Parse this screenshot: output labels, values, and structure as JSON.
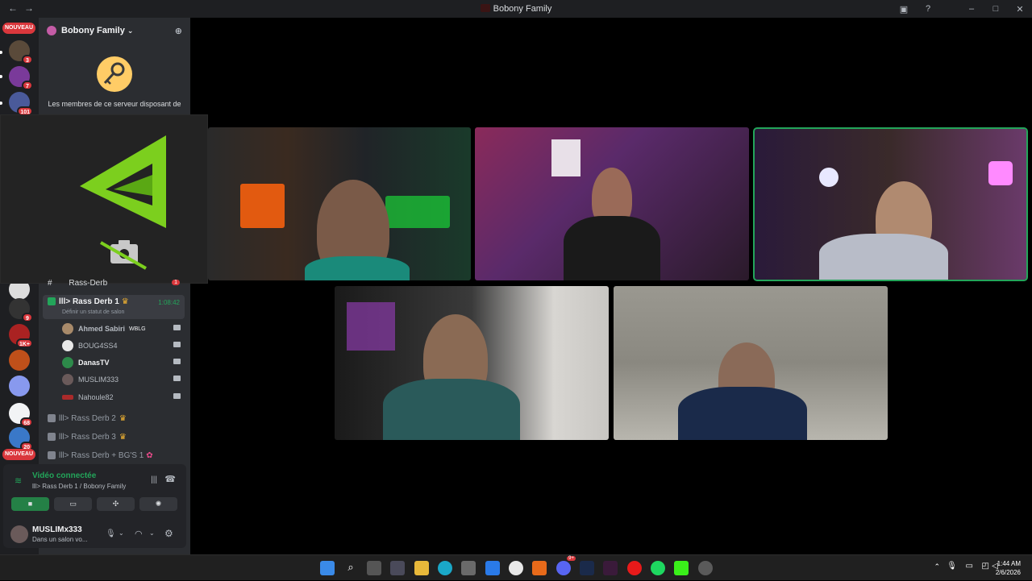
{
  "window": {
    "title": "Bobony Family",
    "nav": "←→"
  },
  "titlebar_icons": [
    "screen-share-icon",
    "help-icon",
    "minimize-icon",
    "maximize-icon",
    "close-icon"
  ],
  "servers": {
    "nouveau_top": "NOUVEAU",
    "nouveau_bottom": "NOUVEAU",
    "badges": [
      "3",
      "7",
      "101",
      "9",
      "1K+",
      "68",
      "20"
    ]
  },
  "guild": {
    "name": "Bobony Family",
    "boost_text": "Les membres de ce serveur disposant de"
  },
  "channels": {
    "partial_channel": "Rass-Derb",
    "partial_badge": "1",
    "active": {
      "name": "lll> Rass Derb 1",
      "timer": "1:08:42",
      "status_hint": "Définir un statut de salon"
    },
    "members": [
      {
        "name": "Ahmed Sabiri",
        "tag": "WBLG"
      },
      {
        "name": "BOUG4SS4",
        "tag": ""
      },
      {
        "name": "DanasTV",
        "tag": ""
      },
      {
        "name": "MUSLIM333",
        "tag": ""
      },
      {
        "name": "Nahoule82",
        "tag": ""
      }
    ],
    "others": [
      "lll> Rass Derb 2",
      "lll> Rass Derb 3",
      "lll> Rass Derb + BG'S 1"
    ]
  },
  "voice_panel": {
    "status": "Vidéo connectée",
    "location": "lll> Rass Derb 1 / Bobony Family",
    "buttons": [
      "camera-icon",
      "screen-share-icon",
      "activities-icon",
      "soundboard-icon"
    ]
  },
  "user": {
    "name": "MUSLIMx333",
    "status": "Dans un salon vo..."
  },
  "clock": {
    "time": "1:44 AM",
    "date": "2/6/2026"
  },
  "taskbar_badge": "9+",
  "colors": {
    "speaking": "#23a55a",
    "badge": "#da373c",
    "sidebar": "#2b2d31",
    "servers": "#1e1f22"
  }
}
